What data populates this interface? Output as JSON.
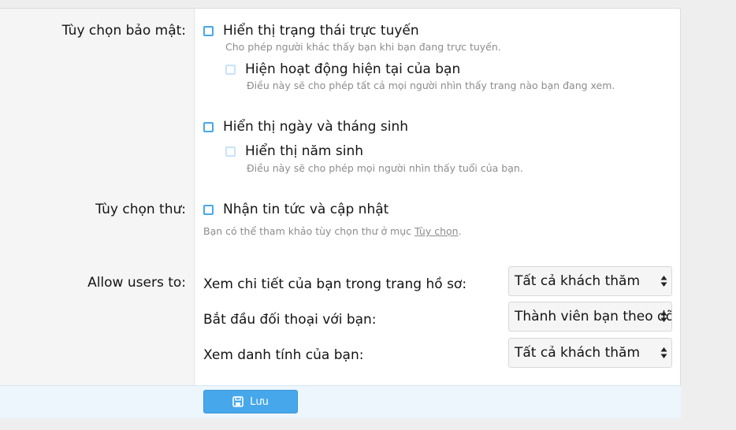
{
  "privacy": {
    "label": "Tùy chọn bảo mật:",
    "online_status": {
      "label": "Hiển thị trạng thái trực tuyến",
      "hint": "Cho phép người khác thấy bạn khi bạn đang trực tuyến."
    },
    "current_activity": {
      "label": "Hiện hoạt động hiện tại của bạn",
      "hint": "Điều này sẽ cho phép tất cả mọi người nhìn thấy trang nào bạn đang xem."
    },
    "birthday": {
      "label": "Hiển thị ngày và tháng sinh"
    },
    "birth_year": {
      "label": "Hiển thị năm sinh",
      "hint": "Điều này sẽ cho phép mọi người nhìn thấy tuổi của bạn."
    }
  },
  "email": {
    "label": "Tùy chọn thư:",
    "news": {
      "label": "Nhận tin tức và cập nhật"
    },
    "hint_prefix": "Bạn có thể tham khảo tùy chọn thư ở mục ",
    "hint_link": "Tùy chọn",
    "hint_suffix": "."
  },
  "allow": {
    "label": "Allow users to:",
    "rows": [
      {
        "label": "Xem chi tiết của bạn trong trang hồ sơ:",
        "value": "Tất cả khách thăm"
      },
      {
        "label": "Bắt đầu đối thoại với bạn:",
        "value": "Thành viên bạn theo dõi"
      },
      {
        "label": "Xem danh tính của bạn:",
        "value": "Tất cả khách thăm"
      }
    ]
  },
  "footer": {
    "save_label": "Lưu"
  },
  "colors": {
    "accent": "#47a7eb",
    "footer_bg": "#edf6fd"
  }
}
